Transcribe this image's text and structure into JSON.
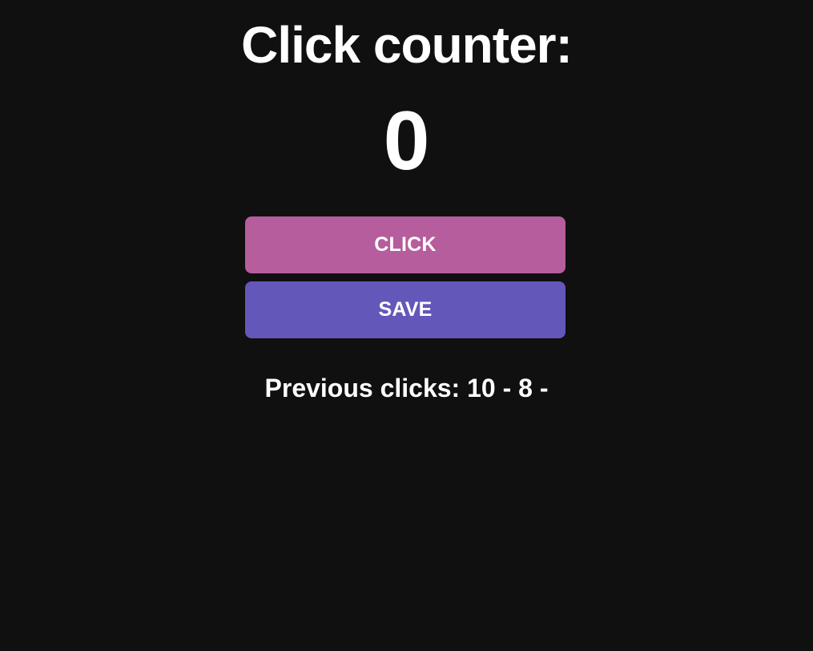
{
  "title": "Click counter:",
  "counter": {
    "value": "0"
  },
  "buttons": {
    "click_label": "CLICK",
    "save_label": "SAVE"
  },
  "history": {
    "text": "Previous clicks: 10 - 8 -"
  },
  "colors": {
    "background": "#101010",
    "click_button": "#b65d9d",
    "save_button": "#6457ba",
    "text": "#ffffff"
  }
}
